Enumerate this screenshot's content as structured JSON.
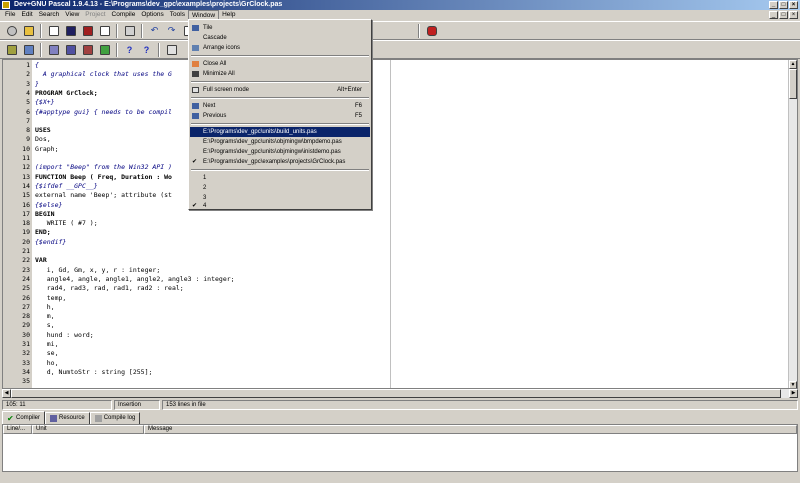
{
  "window": {
    "title": "Dev+GNU Pascal 1.9.4.13 - E:\\Programs\\dev_gpc\\examples\\projects\\GrClock.pas"
  },
  "menubar": [
    {
      "label": "File",
      "disabled": false
    },
    {
      "label": "Edit",
      "disabled": false
    },
    {
      "label": "Search",
      "disabled": false
    },
    {
      "label": "View",
      "disabled": false
    },
    {
      "label": "Project",
      "disabled": true
    },
    {
      "label": "Compile",
      "disabled": false
    },
    {
      "label": "Options",
      "disabled": false
    },
    {
      "label": "Tools",
      "disabled": false
    },
    {
      "label": "Window",
      "disabled": false,
      "active": true
    },
    {
      "label": "Help",
      "disabled": false
    }
  ],
  "editor": {
    "lines": [
      {
        "n": "1",
        "text": "{",
        "style": "comment"
      },
      {
        "n": "2",
        "text": "  A graphical clock that uses the G",
        "style": "comment"
      },
      {
        "n": "3",
        "text": "}",
        "style": "comment"
      },
      {
        "n": "4",
        "text": "PROGRAM GrClock;",
        "style": "kw"
      },
      {
        "n": "5",
        "text": "{$X+}",
        "style": "comment"
      },
      {
        "n": "6",
        "text": "{#apptype gui} { needs to be compil",
        "style": "comment"
      },
      {
        "n": "7",
        "text": "",
        "style": ""
      },
      {
        "n": "8",
        "text": "USES",
        "style": "kw"
      },
      {
        "n": "9",
        "text": "Dos,",
        "style": ""
      },
      {
        "n": "10",
        "text": "Graph;",
        "style": ""
      },
      {
        "n": "11",
        "text": "",
        "style": ""
      },
      {
        "n": "12",
        "text": "(import \"Beep\" from the Win32 API )",
        "style": "comment"
      },
      {
        "n": "13",
        "text": "FUNCTION Beep ( Freq, Duration : Wo",
        "style": "kw"
      },
      {
        "n": "14",
        "text": "{$ifdef __GPC__}",
        "style": "comment"
      },
      {
        "n": "15",
        "text": "external name 'Beep'; attribute (st",
        "style": ""
      },
      {
        "n": "16",
        "text": "{$else}",
        "style": "comment"
      },
      {
        "n": "17",
        "text": "BEGIN",
        "style": "kw"
      },
      {
        "n": "18",
        "text": "   WRITE ( #7 );",
        "style": ""
      },
      {
        "n": "19",
        "text": "END;",
        "style": "kw"
      },
      {
        "n": "20",
        "text": "{$endif}",
        "style": "comment"
      },
      {
        "n": "21",
        "text": "",
        "style": ""
      },
      {
        "n": "22",
        "text": "VAR",
        "style": "kw"
      },
      {
        "n": "23",
        "text": "   i, Gd, Gm, x, y, r : integer;",
        "style": ""
      },
      {
        "n": "24",
        "text": "   angle4, angle, angle1, angle2, angle3 : integer;",
        "style": ""
      },
      {
        "n": "25",
        "text": "   rad4, rad3, rad, rad1, rad2 : real;",
        "style": ""
      },
      {
        "n": "26",
        "text": "   temp,",
        "style": ""
      },
      {
        "n": "27",
        "text": "   h,",
        "style": ""
      },
      {
        "n": "28",
        "text": "   m,",
        "style": ""
      },
      {
        "n": "29",
        "text": "   s,",
        "style": ""
      },
      {
        "n": "30",
        "text": "   hund : word;",
        "style": ""
      },
      {
        "n": "31",
        "text": "   mi,",
        "style": ""
      },
      {
        "n": "32",
        "text": "   se,",
        "style": ""
      },
      {
        "n": "33",
        "text": "   ho,",
        "style": ""
      },
      {
        "n": "34",
        "text": "   d, NumtoStr : string [255];",
        "style": ""
      },
      {
        "n": "35",
        "text": "",
        "style": ""
      }
    ]
  },
  "statusbar": {
    "position": "105: 11",
    "mode": "Insertion",
    "info": "153 lines in file"
  },
  "message_tabs": [
    {
      "label": "Compiler",
      "icon": "check-icon"
    },
    {
      "label": "Resource",
      "icon": "resource-icon"
    },
    {
      "label": "Compile log",
      "icon": "log-icon"
    }
  ],
  "message_columns": [
    "Line/...",
    "Unit",
    "Message"
  ],
  "window_menu": {
    "items": [
      {
        "label": "Tile",
        "shortcut": "",
        "icon": "tile-icon"
      },
      {
        "label": "Cascade",
        "shortcut": "",
        "icon": ""
      },
      {
        "label": "Arrange icons",
        "shortcut": "",
        "icon": "arrange-icon"
      },
      {
        "label": "Close All",
        "shortcut": "",
        "icon": "close-all-icon"
      },
      {
        "label": "Minimize All",
        "shortcut": "",
        "icon": "minimize-all-icon"
      },
      {
        "label": "Full screen mode",
        "shortcut": "Alt+Enter",
        "icon": "fullscreen-icon"
      },
      {
        "label": "Next",
        "shortcut": "F6",
        "icon": "next-icon"
      },
      {
        "label": "Previous",
        "shortcut": "F5",
        "icon": "previous-icon"
      },
      {
        "label": "E:\\Programs\\dev_gpc\\units\\build_units.pas",
        "shortcut": "",
        "icon": ""
      },
      {
        "label": "E:\\Programs\\dev_gpc\\units\\objmingw\\bmpdemo.pas",
        "shortcut": "",
        "icon": ""
      },
      {
        "label": "E:\\Programs\\dev_gpc\\units\\objmingw\\inistdemo.pas",
        "shortcut": "",
        "icon": ""
      },
      {
        "label": "E:\\Programs\\dev_gpc\\examples\\projects\\GrClock.pas",
        "shortcut": "",
        "icon": "check-icon"
      },
      {
        "label": "1",
        "shortcut": "",
        "icon": ""
      },
      {
        "label": "2",
        "shortcut": "",
        "icon": ""
      },
      {
        "label": "3",
        "shortcut": "",
        "icon": ""
      },
      {
        "label": "4",
        "shortcut": "",
        "icon": "check-icon"
      }
    ]
  },
  "colors": {
    "title_start": "#0a246a",
    "title_end": "#a6caf0",
    "highlight": "#0a246a",
    "comment": "#000080"
  }
}
